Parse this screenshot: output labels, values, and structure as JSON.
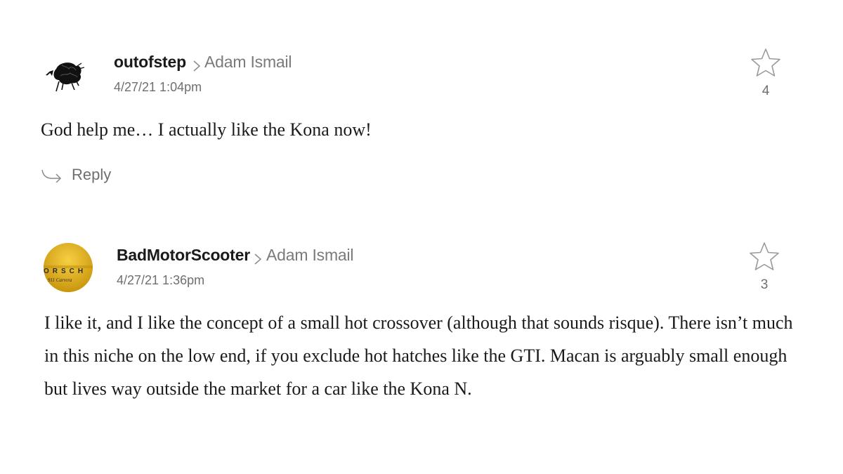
{
  "comments": [
    {
      "username": "outofstep",
      "reply_to": "Adam Ismail",
      "timestamp": "4/27/21 1:04pm",
      "star_count": "4",
      "body": "God help me… I actually like the Kona now!",
      "reply_label": "Reply",
      "avatar_icon": "sheep-doodle-avatar"
    },
    {
      "username": "BadMotorScooter",
      "reply_to": "Adam Ismail",
      "timestamp": "4/27/21 1:36pm",
      "star_count": "3",
      "body": "I like it, and I like the concept of a small hot crossover (although that sounds risque). There isn’t much in this niche on the low end, if you exclude hot hatches like the GTI. Macan is arguably small enough but lives way outside the market for a car like the Kona N.",
      "avatar_icon": "porsche-badge-avatar",
      "avatar_text": {
        "brand": "ORSCH",
        "model": "911 Carrera"
      }
    }
  ],
  "colors": {
    "username": "#1a1a1a",
    "meta": "#6f6f6f",
    "star_outline": "#9a9a9a",
    "avatar_gold": "#e3b320"
  }
}
